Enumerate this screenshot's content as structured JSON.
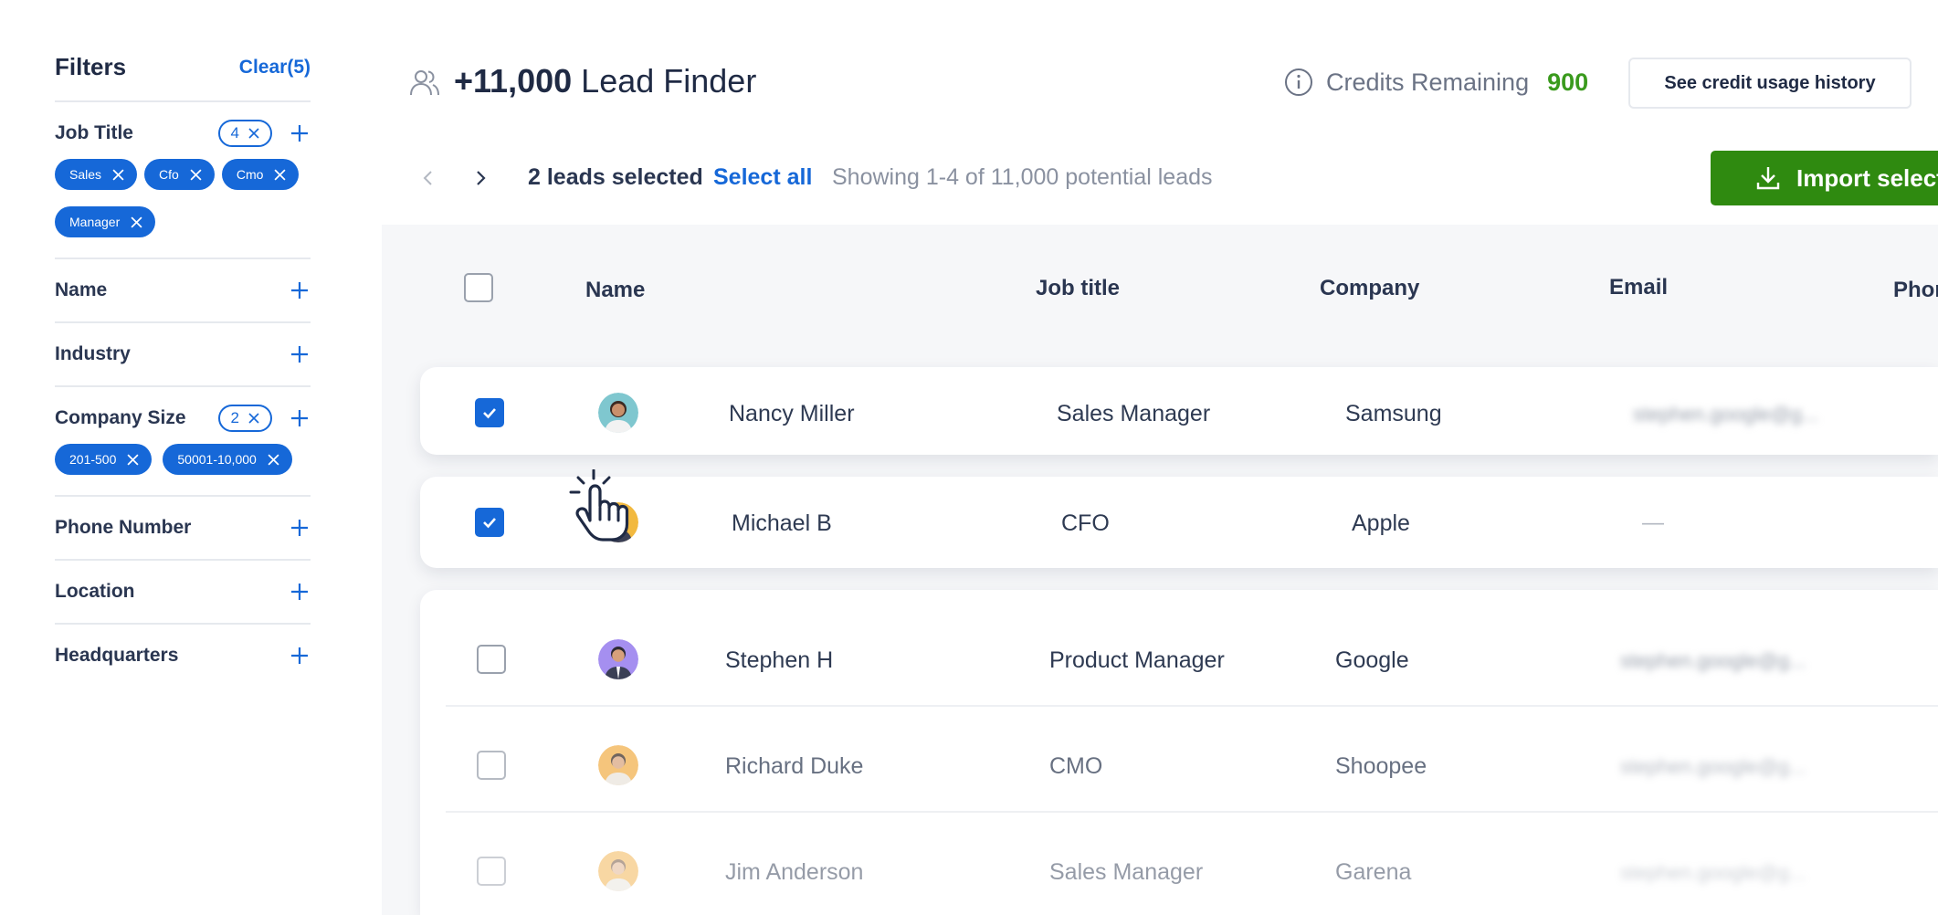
{
  "sidebar": {
    "title": "Filters",
    "clear_label": "Clear(5)",
    "filters": [
      {
        "label": "Job Title",
        "badge": "4",
        "chips": [
          "Sales",
          "Cfo",
          "Cmo",
          "Manager"
        ]
      },
      {
        "label": "Name"
      },
      {
        "label": "Industry"
      },
      {
        "label": "Company Size",
        "badge": "2",
        "chips": [
          "201-500",
          "50001-10,000"
        ]
      },
      {
        "label": "Phone Number"
      },
      {
        "label": "Location"
      },
      {
        "label": "Headquarters"
      }
    ]
  },
  "header": {
    "title_count": "+11,000",
    "title_text": "Lead Finder",
    "credits_label": "Credits Remaining",
    "credits_value": "900",
    "history_button": "See credit usage history"
  },
  "toolbar": {
    "selected_text": "2 leads selected",
    "select_all": "Select all",
    "showing": "Showing 1-4 of 11,000 potential leads",
    "import_label": "Import selected"
  },
  "table": {
    "columns": [
      "Name",
      "Job title",
      "Company",
      "Email",
      "Phone"
    ],
    "rows": [
      {
        "name": "Nancy Miller",
        "job_title": "Sales Manager",
        "company": "Samsung",
        "email": "stephen.google@g...",
        "checked": true
      },
      {
        "name": "Michael B",
        "job_title": "CFO",
        "company": "Apple",
        "email": "—",
        "checked": true
      },
      {
        "name": "Stephen H",
        "job_title": "Product Manager",
        "company": "Google",
        "email": "stephen.google@g...",
        "checked": false
      },
      {
        "name": "Richard Duke",
        "job_title": "CMO",
        "company": "Shoopee",
        "email": "stephen.google@g...",
        "checked": false
      },
      {
        "name": "Jim Anderson",
        "job_title": "Sales Manager",
        "company": "Garena",
        "email": "stephen.google@g...",
        "checked": false
      }
    ]
  },
  "colors": {
    "accent": "#1668d8",
    "import_green": "#2f8a10",
    "credits_green": "#3a9a1d",
    "text_dark": "#1f2a44"
  },
  "icons": [
    "users-icon",
    "info-icon",
    "download-icon",
    "plus-icon",
    "close-icon",
    "chevron-left-icon",
    "chevron-right-icon",
    "check-icon",
    "hand-cursor-icon"
  ]
}
